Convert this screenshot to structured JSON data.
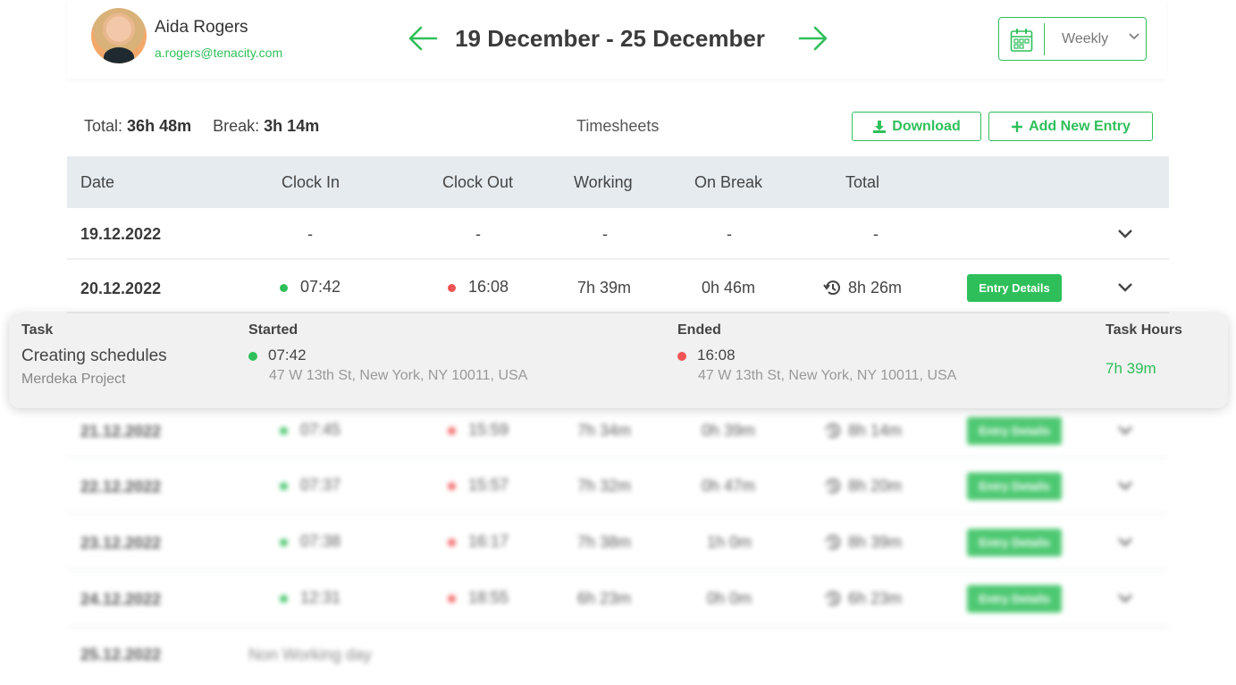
{
  "user": {
    "name": "Aida Rogers",
    "email": "a.rogers@tenacity.com"
  },
  "date_range": "19 December - 25 December",
  "period": {
    "selected": "Weekly"
  },
  "summary": {
    "total_label": "Total:",
    "total_value": "36h 48m",
    "break_label": "Break:",
    "break_value": "3h 14m",
    "section_title": "Timesheets"
  },
  "actions": {
    "download": "Download",
    "add_entry": "Add New Entry"
  },
  "columns": [
    "Date",
    "Clock In",
    "Clock Out",
    "Working",
    "On Break",
    "Total"
  ],
  "rows": [
    {
      "date": "19.12.2022",
      "clock_in": "-",
      "clock_out": "-",
      "working": "-",
      "on_break": "-",
      "total": "-"
    },
    {
      "date": "20.12.2022",
      "clock_in": "07:42",
      "clock_out": "16:08",
      "working": "7h 39m",
      "on_break": "0h 46m",
      "total": "8h 26m",
      "details": "Entry Details"
    },
    {
      "date": "21.12.2022",
      "clock_in": "07:45",
      "clock_out": "15:59",
      "working": "7h 34m",
      "on_break": "0h 39m",
      "total": "8h 14m",
      "details": "Entry Details"
    },
    {
      "date": "22.12.2022",
      "clock_in": "07:37",
      "clock_out": "15:57",
      "working": "7h 32m",
      "on_break": "0h 47m",
      "total": "8h 20m",
      "details": "Entry Details"
    },
    {
      "date": "23.12.2022",
      "clock_in": "07:38",
      "clock_out": "16:17",
      "working": "7h 38m",
      "on_break": "1h 0m",
      "total": "8h 39m",
      "details": "Entry Details"
    },
    {
      "date": "24.12.2022",
      "clock_in": "12:31",
      "clock_out": "18:55",
      "working": "6h 23m",
      "on_break": "0h 0m",
      "total": "6h 23m",
      "details": "Entry Details"
    },
    {
      "date": "25.12.2022",
      "note": "Non Working day"
    }
  ],
  "detail": {
    "headers": {
      "task": "Task",
      "started": "Started",
      "ended": "Ended",
      "hours": "Task Hours"
    },
    "task_name": "Creating schedules",
    "project": "Merdeka Project",
    "started_time": "07:42",
    "started_address": "47 W 13th St, New York, NY 10011, USA",
    "ended_time": "16:08",
    "ended_address": "47 W 13th St, New York, NY 10011, USA",
    "hours": "7h 39m"
  },
  "colors": {
    "accent": "#2fbf5a",
    "clock_out": "#f05454",
    "table_header": "#e6ebef"
  },
  "icons": [
    "arrow-left-icon",
    "arrow-right-icon",
    "calendar-icon",
    "chevron-down-icon",
    "download-icon",
    "plus-icon",
    "history-icon"
  ]
}
